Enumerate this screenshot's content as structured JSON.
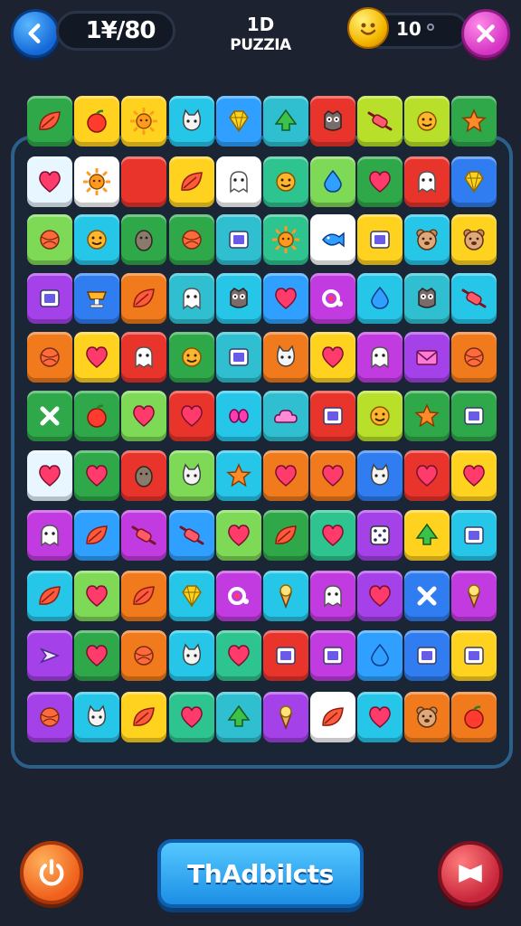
{
  "header": {
    "back_icon": "chevron-left-icon",
    "score": "1¥/80",
    "title_top": "1D",
    "title": "PUZZIA",
    "coins": "10",
    "coin_icon": "smiley-coin-icon",
    "close_icon": "close-icon"
  },
  "board": {
    "columns": 10,
    "rows": 11,
    "tiles": [
      [
        {
          "c": "#2fa84a",
          "i": "leaf"
        },
        {
          "c": "#ffd21f",
          "i": "apple"
        },
        {
          "c": "#ffd21f",
          "i": "sun"
        },
        {
          "c": "#26c6e8",
          "i": "cat"
        },
        {
          "c": "#2fa0ff",
          "i": "gem"
        },
        {
          "c": "#2fbfd0",
          "i": "tree"
        },
        {
          "c": "#e8342b",
          "i": "owl"
        },
        {
          "c": "#b8e02a",
          "i": "candy"
        },
        {
          "c": "#b8e02a",
          "i": "face"
        },
        {
          "c": "#2fa84a",
          "i": "star"
        }
      ],
      [
        {
          "c": "#e8f6ff",
          "i": "heart"
        },
        {
          "c": "#ffffff",
          "i": "sun"
        },
        {
          "c": "#e8342b",
          "i": "lion"
        },
        {
          "c": "#ffd21f",
          "i": "leaf"
        },
        {
          "c": "#ffffff",
          "i": "ghost"
        },
        {
          "c": "#2ec48f",
          "i": "face"
        },
        {
          "c": "#7ed957",
          "i": "drop"
        },
        {
          "c": "#2fa84a",
          "i": "heart"
        },
        {
          "c": "#e8342b",
          "i": "ghost"
        },
        {
          "c": "#2f7df0",
          "i": "gem"
        }
      ],
      [
        {
          "c": "#7ed957",
          "i": "ball"
        },
        {
          "c": "#26c6e8",
          "i": "face"
        },
        {
          "c": "#2fa84a",
          "i": "egg"
        },
        {
          "c": "#2fa84a",
          "i": "ball"
        },
        {
          "c": "#2fbfd0",
          "i": "box"
        },
        {
          "c": "#2ec48f",
          "i": "sun"
        },
        {
          "c": "#ffffff",
          "i": "fish"
        },
        {
          "c": "#ffd21f",
          "i": "box"
        },
        {
          "c": "#26c6e8",
          "i": "bear"
        },
        {
          "c": "#ffd21f",
          "i": "bear"
        }
      ],
      [
        {
          "c": "#a541e8",
          "i": "box"
        },
        {
          "c": "#2f7df0",
          "i": "cup"
        },
        {
          "c": "#f07a1c",
          "i": "leaf"
        },
        {
          "c": "#2fbfd0",
          "i": "ghost"
        },
        {
          "c": "#26c6e8",
          "i": "owl"
        },
        {
          "c": "#2fa0ff",
          "i": "heart"
        },
        {
          "c": "#c23be0",
          "i": "ring"
        },
        {
          "c": "#26c6e8",
          "i": "drop"
        },
        {
          "c": "#2fbfd0",
          "i": "owl"
        },
        {
          "c": "#26c6e8",
          "i": "candy"
        }
      ],
      [
        {
          "c": "#f07a1c",
          "i": "ball"
        },
        {
          "c": "#ffd21f",
          "i": "heart"
        },
        {
          "c": "#e8342b",
          "i": "ghost"
        },
        {
          "c": "#2fa84a",
          "i": "face"
        },
        {
          "c": "#2fbfd0",
          "i": "box"
        },
        {
          "c": "#f07a1c",
          "i": "cat"
        },
        {
          "c": "#ffd21f",
          "i": "heart"
        },
        {
          "c": "#c23be0",
          "i": "ghost"
        },
        {
          "c": "#a541e8",
          "i": "mail"
        },
        {
          "c": "#f07a1c",
          "i": "ball"
        }
      ],
      [
        {
          "c": "#2fa84a",
          "i": "cross"
        },
        {
          "c": "#2fa84a",
          "i": "apple"
        },
        {
          "c": "#7ed957",
          "i": "heart"
        },
        {
          "c": "#e8342b",
          "i": "heart"
        },
        {
          "c": "#26c6e8",
          "i": "eyes"
        },
        {
          "c": "#2fbfd0",
          "i": "cloud"
        },
        {
          "c": "#e8342b",
          "i": "box"
        },
        {
          "c": "#b8e02a",
          "i": "face"
        },
        {
          "c": "#2fa84a",
          "i": "star"
        },
        {
          "c": "#2fa84a",
          "i": "box"
        }
      ],
      [
        {
          "c": "#e8f6ff",
          "i": "heart"
        },
        {
          "c": "#2fa84a",
          "i": "heart"
        },
        {
          "c": "#e8342b",
          "i": "egg"
        },
        {
          "c": "#7ed957",
          "i": "cat"
        },
        {
          "c": "#26c6e8",
          "i": "star"
        },
        {
          "c": "#f07a1c",
          "i": "heart"
        },
        {
          "c": "#f07a1c",
          "i": "heart"
        },
        {
          "c": "#2f7df0",
          "i": "cat"
        },
        {
          "c": "#e8342b",
          "i": "heart"
        },
        {
          "c": "#ffd21f",
          "i": "heart"
        }
      ],
      [
        {
          "c": "#c23be0",
          "i": "ghost"
        },
        {
          "c": "#2fa0ff",
          "i": "leaf"
        },
        {
          "c": "#c23be0",
          "i": "candy"
        },
        {
          "c": "#2fa0ff",
          "i": "candy"
        },
        {
          "c": "#7ed957",
          "i": "heart"
        },
        {
          "c": "#2fa84a",
          "i": "leaf"
        },
        {
          "c": "#2ec48f",
          "i": "heart"
        },
        {
          "c": "#a541e8",
          "i": "dice"
        },
        {
          "c": "#ffd21f",
          "i": "tree"
        },
        {
          "c": "#26c6e8",
          "i": "box"
        }
      ],
      [
        {
          "c": "#26c6e8",
          "i": "leaf"
        },
        {
          "c": "#7ed957",
          "i": "heart"
        },
        {
          "c": "#f07a1c",
          "i": "leaf"
        },
        {
          "c": "#26c6e8",
          "i": "gem"
        },
        {
          "c": "#c23be0",
          "i": "ring"
        },
        {
          "c": "#26c6e8",
          "i": "cone"
        },
        {
          "c": "#c23be0",
          "i": "ghost"
        },
        {
          "c": "#a541e8",
          "i": "heart"
        },
        {
          "c": "#2f7df0",
          "i": "cross"
        },
        {
          "c": "#c23be0",
          "i": "cone"
        }
      ],
      [
        {
          "c": "#a541e8",
          "i": "arrow"
        },
        {
          "c": "#2fa84a",
          "i": "heart"
        },
        {
          "c": "#f07a1c",
          "i": "ball"
        },
        {
          "c": "#26c6e8",
          "i": "cat"
        },
        {
          "c": "#2ec48f",
          "i": "heart"
        },
        {
          "c": "#e8342b",
          "i": "box"
        },
        {
          "c": "#c23be0",
          "i": "box"
        },
        {
          "c": "#2fa0ff",
          "i": "drop"
        },
        {
          "c": "#2f7df0",
          "i": "box"
        },
        {
          "c": "#ffd21f",
          "i": "box"
        }
      ],
      [
        {
          "c": "#a541e8",
          "i": "ball"
        },
        {
          "c": "#26c6e8",
          "i": "cat"
        },
        {
          "c": "#ffd21f",
          "i": "leaf"
        },
        {
          "c": "#2ec48f",
          "i": "heart"
        },
        {
          "c": "#2fbfd0",
          "i": "tree"
        },
        {
          "c": "#a541e8",
          "i": "cone"
        },
        {
          "c": "#ffffff",
          "i": "leaf"
        },
        {
          "c": "#26c6e8",
          "i": "heart"
        },
        {
          "c": "#f07a1c",
          "i": "bear"
        },
        {
          "c": "#f07a1c",
          "i": "apple"
        }
      ]
    ]
  },
  "footer": {
    "power_icon": "power-icon",
    "main_button_label": "ThAdbilcts",
    "flag_icon": "flag-icon"
  },
  "colors": {
    "background": "#1c2230",
    "board_border": "#2c5f8a",
    "accent_blue": "#1c8fe6",
    "accent_pink": "#d534c4",
    "accent_orange": "#f0601c",
    "accent_red": "#c8263a"
  }
}
